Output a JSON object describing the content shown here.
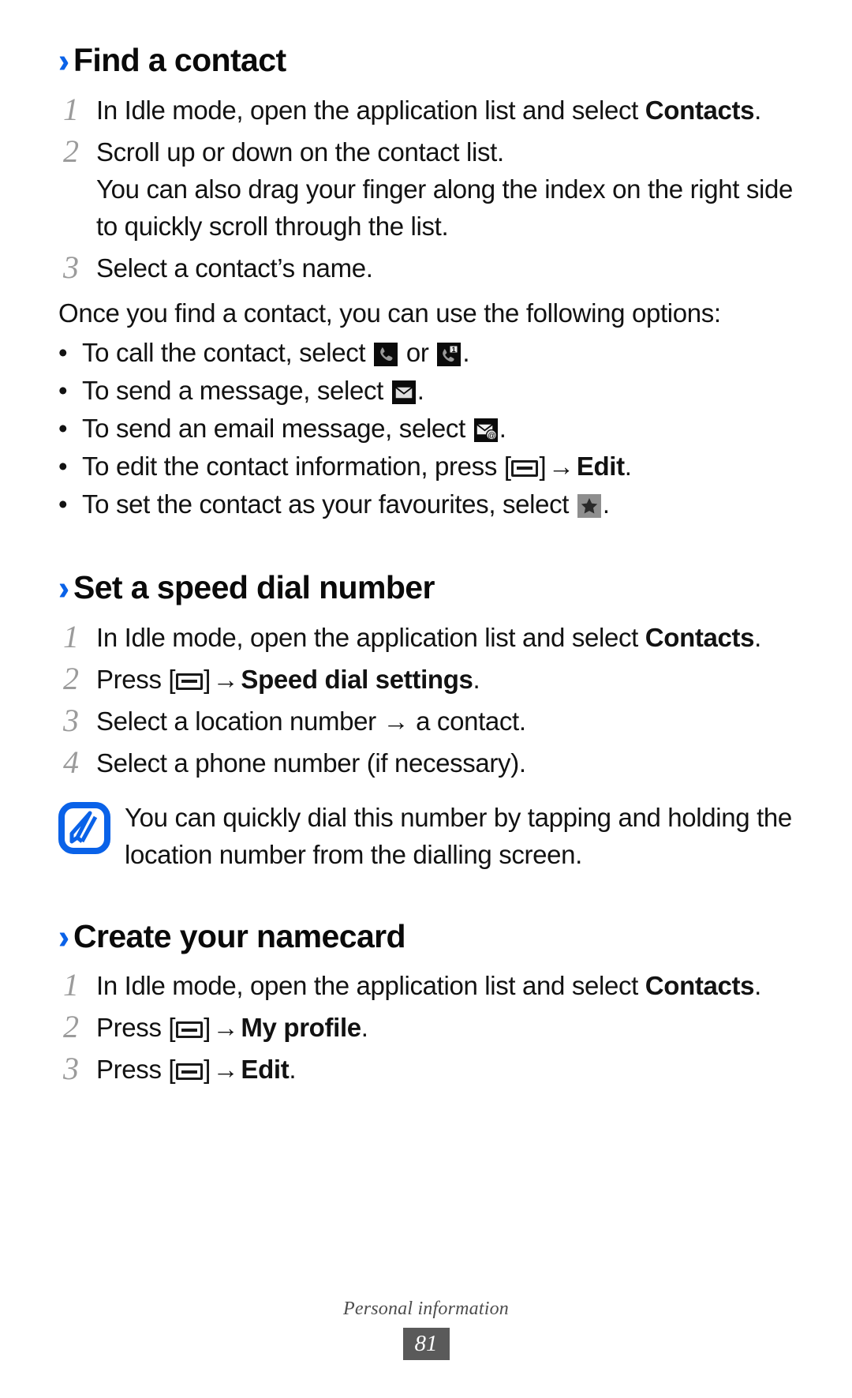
{
  "document": {
    "type": "user-manual-page",
    "chapter": "Personal information",
    "page_number": "81",
    "accent_color": "#0a62e8",
    "heading_marker": "››"
  },
  "sections": [
    {
      "id": "find-a-contact",
      "title": "Find a contact",
      "steps": [
        {
          "num": "1",
          "text_before": "In Idle mode, open the application list and select ",
          "bold": "Contacts",
          "text_after": "."
        },
        {
          "num": "2",
          "text_before": "Scroll up or down on the contact list.",
          "extra": "You can also drag your finger along the index on the right side to quickly scroll through the list."
        },
        {
          "num": "3",
          "text_before": "Select a contact’s name."
        }
      ],
      "intro": "Once you find a contact, you can use the following options:",
      "bullets": [
        {
          "id": "call-contact",
          "part1": "To call the contact, select ",
          "icon1": "phone-call-icon",
          "part2": " or ",
          "icon2": "video-call-icon",
          "part3": "."
        },
        {
          "id": "send-message",
          "part1": "To send a message, select ",
          "icon1": "message-envelope-icon",
          "part3": "."
        },
        {
          "id": "send-email",
          "part1": "To send an email message, select ",
          "icon1": "email-at-icon",
          "part3": "."
        },
        {
          "id": "edit-contact",
          "part1": "To edit the contact information, press ",
          "menukey": true,
          "arrow": "→",
          "bold": "Edit",
          "part3": "."
        },
        {
          "id": "set-favourite",
          "part1": "To set the contact as your favourites, select ",
          "icon1": "favourite-star-icon",
          "part3": "."
        }
      ]
    },
    {
      "id": "set-a-speed-dial-number",
      "title": "Set a speed dial number",
      "steps": [
        {
          "num": "1",
          "text_before": "In Idle mode, open the application list and select ",
          "bold": "Contacts",
          "text_after": "."
        },
        {
          "num": "2",
          "text_before": "Press ",
          "menukey": true,
          "arrow": "→",
          "bold": "Speed dial settings",
          "text_after": "."
        },
        {
          "num": "3",
          "text_before": "Select a location number → a contact."
        },
        {
          "num": "4",
          "text_before": "Select a phone number (if necessary)."
        }
      ],
      "note": {
        "icon": "note-pencil-icon",
        "icon_color": "#0a62e8",
        "text": "You can quickly dial this number by tapping and holding the location number from the dialling screen."
      }
    },
    {
      "id": "create-your-namecard",
      "title": "Create your namecard",
      "steps": [
        {
          "num": "1",
          "text_before": "In Idle mode, open the application list and select ",
          "bold": "Contacts",
          "text_after": "."
        },
        {
          "num": "2",
          "text_before": "Press ",
          "menukey": true,
          "arrow": "→",
          "bold": "My profile",
          "text_after": "."
        },
        {
          "num": "3",
          "text_before": "Press ",
          "menukey": true,
          "arrow": "→",
          "bold": "Edit",
          "text_after": "."
        }
      ]
    }
  ],
  "footer": {
    "chapter": "Personal information",
    "page": "81"
  }
}
